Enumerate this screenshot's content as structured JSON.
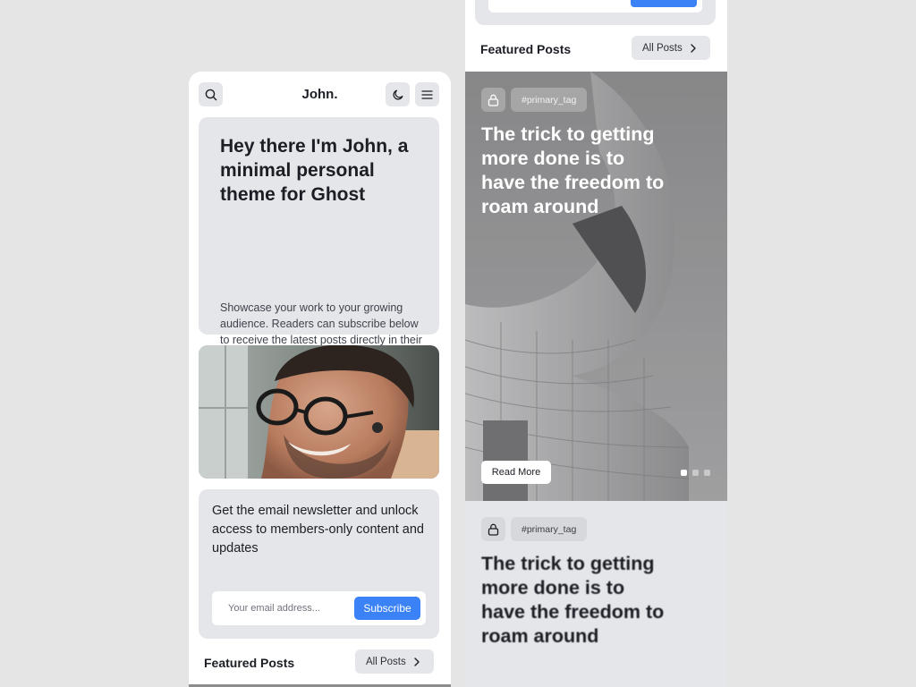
{
  "left": {
    "brand": "John.",
    "hero": {
      "title": "Hey there I'm John, a minimal personal theme for Ghost",
      "description": "Showcase your work to your growing audience. Readers can subscribe below to receive the latest posts directly in their inbox"
    },
    "newsletter": {
      "text": "Get the email newsletter and unlock access to members-only content and updates",
      "placeholder": "Your email address...",
      "button": "Subscribe"
    },
    "featured": {
      "title": "Featured Posts",
      "all_posts": "All Posts"
    }
  },
  "right": {
    "featured": {
      "title": "Featured Posts",
      "all_posts": "All Posts"
    },
    "slide": {
      "tag": "#primary_tag",
      "title": "The trick to getting more done is to have the freedom to roam around",
      "read_more": "Read More"
    },
    "slide2": {
      "tag": "#primary_tag",
      "title": "The trick to getting more done is to have the freedom to roam around"
    }
  },
  "colors": {
    "accent": "#3b82f6",
    "card": "#e5e6ea",
    "background": "#e5e5e6",
    "text": "#1b1e24"
  },
  "icons": [
    "search-icon",
    "moon-icon",
    "menu-icon",
    "chevron-right-icon",
    "lock-icon"
  ]
}
